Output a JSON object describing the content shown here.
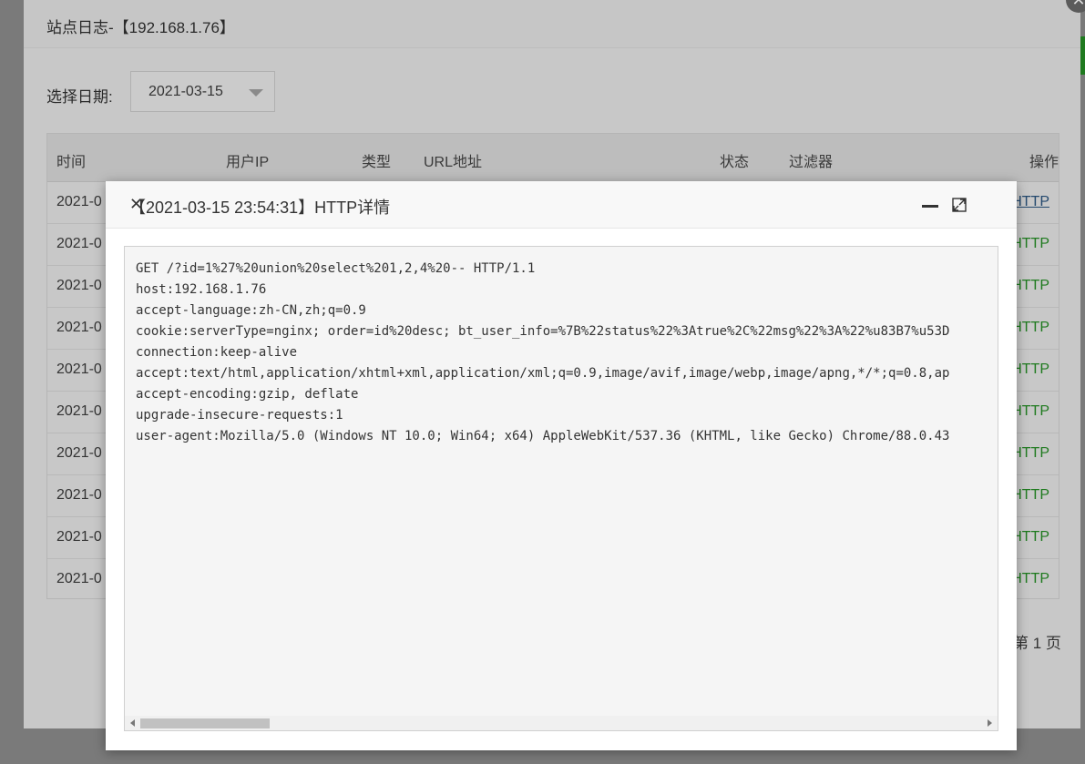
{
  "outer_dialog": {
    "title": "站点日志-【192.168.1.76】",
    "date_label": "选择日期:",
    "date_value": "2021-03-15",
    "pager_text": "第 1 页"
  },
  "table": {
    "headers": [
      "时间",
      "用户IP",
      "类型",
      "URL地址",
      "状态",
      "过滤器",
      "操作"
    ],
    "rows": [
      {
        "time": "2021-0",
        "action": "HTTP"
      },
      {
        "time": "2021-0",
        "action": "HTTP"
      },
      {
        "time": "2021-0",
        "action": "HTTP"
      },
      {
        "time": "2021-0",
        "action": "HTTP"
      },
      {
        "time": "2021-0",
        "action": "HTTP"
      },
      {
        "time": "2021-0",
        "action": "HTTP"
      },
      {
        "time": "2021-0",
        "action": "HTTP"
      },
      {
        "time": "2021-0",
        "action": "HTTP"
      },
      {
        "time": "2021-0",
        "action": "HTTP"
      },
      {
        "time": "2021-0",
        "action": "HTTP"
      }
    ]
  },
  "http_dialog": {
    "title": "【2021-03-15 23:54:31】HTTP详情",
    "request_lines": [
      "GET /?id=1%27%20union%20select%201,2,4%20-- HTTP/1.1",
      "host:192.168.1.76",
      "accept-language:zh-CN,zh;q=0.9",
      "cookie:serverType=nginx; order=id%20desc; bt_user_info=%7B%22status%22%3Atrue%2C%22msg%22%3A%22%u83B7%u53D",
      "connection:keep-alive",
      "accept:text/html,application/xhtml+xml,application/xml;q=0.9,image/avif,image/webp,image/apng,*/*;q=0.8,ap",
      "accept-encoding:gzip, deflate",
      "upgrade-insecure-requests:1",
      "user-agent:Mozilla/5.0 (Windows NT 10.0; Win64; x64) AppleWebKit/537.36 (KHTML, like Gecko) Chrome/88.0.43"
    ]
  },
  "icons": [
    "minimize-icon",
    "maximize-icon",
    "close-icon",
    "dropdown-caret-icon"
  ],
  "colors": {
    "http_link": "#1e7a1e",
    "overlay": "#6f6f6f"
  }
}
